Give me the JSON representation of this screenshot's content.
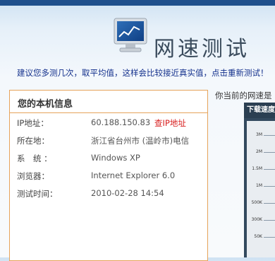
{
  "header": {
    "title": "网速测试"
  },
  "tip": "建议您多测几次，取平均值，这样会比较接近真实值，点击重新测试！",
  "info": {
    "heading": "您的本机信息",
    "rows": [
      {
        "label": "IP地址：",
        "value": "60.188.150.83",
        "link": "查IP地址"
      },
      {
        "label": "所在地：",
        "value": "浙江省台州市 (温岭市)电信"
      },
      {
        "label": "系　统 ：",
        "value": "Windows XP"
      },
      {
        "label": "浏览器：",
        "value": "Internet Explorer 6.0"
      },
      {
        "label": "测试时间：",
        "value": "2010-02-28 14:54"
      }
    ]
  },
  "speed": {
    "label": "你当前的网速是",
    "panel_title": "下载速度",
    "scale": [
      "3M",
      "2M",
      "1.5M",
      "1M",
      "500K",
      "300K",
      "50K"
    ]
  }
}
